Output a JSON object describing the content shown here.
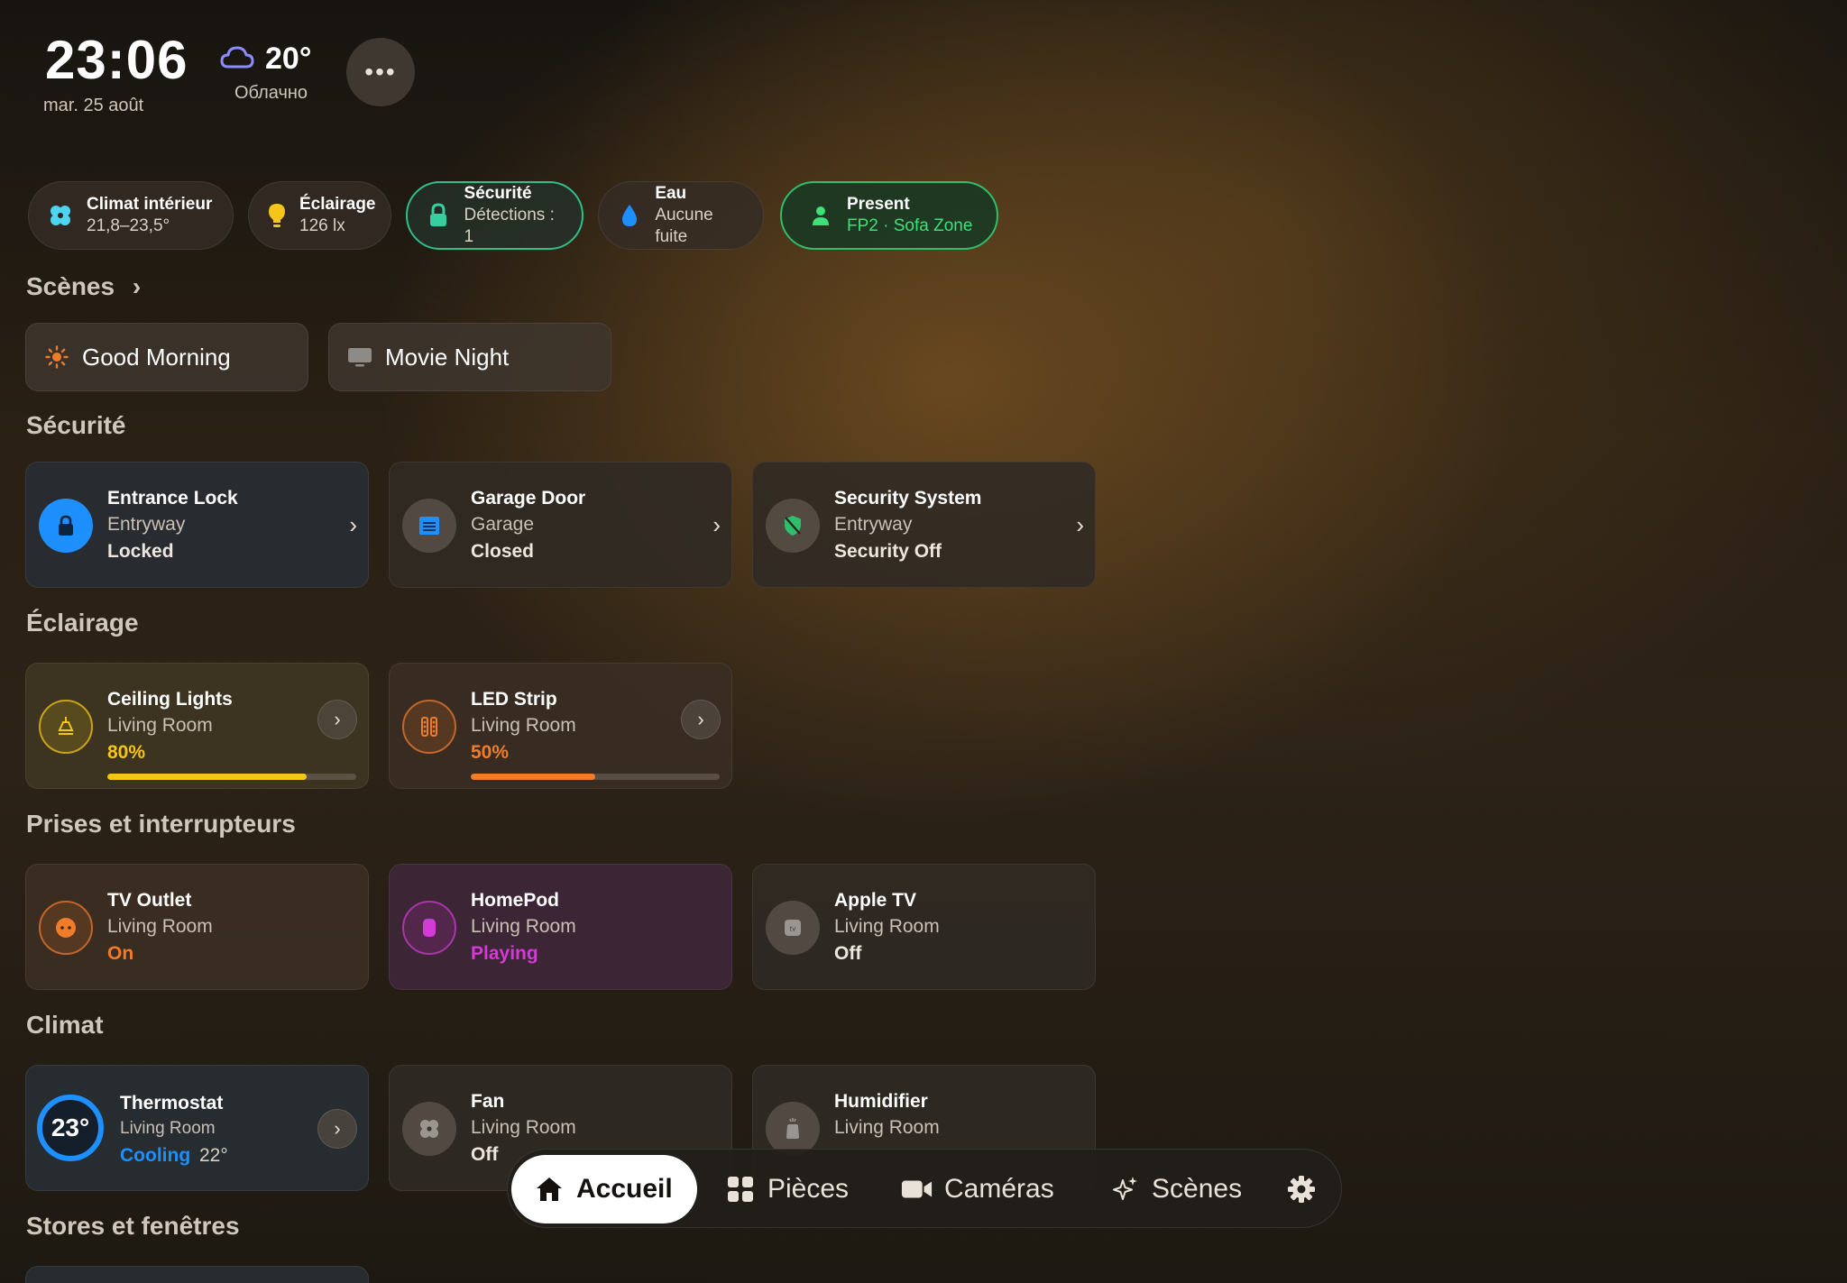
{
  "header": {
    "time": "23:06",
    "date": "mar. 25 août",
    "temperature": "20°",
    "condition": "Облачно",
    "more_label": "•••"
  },
  "status_chips": [
    {
      "title": "Climat intérieur",
      "subtitle": "21,8–23,5°",
      "icon": "fan-icon"
    },
    {
      "title": "Éclairage",
      "subtitle": "126 lx",
      "icon": "bulb-icon"
    },
    {
      "title": "Sécurité",
      "subtitle": "Détections : 1",
      "icon": "lock-icon"
    },
    {
      "title": "Eau",
      "subtitle": "Aucune fuite",
      "icon": "water-drop-icon"
    },
    {
      "title": "Present",
      "subtitle": "FP2 · Sofa Zone",
      "icon": "person-icon"
    }
  ],
  "sections": {
    "scenes": "Scènes",
    "security": "Sécurité",
    "lighting": "Éclairage",
    "outlets": "Prises et interrupteurs",
    "climate": "Climat",
    "blinds": "Stores et fenêtres"
  },
  "scenes": [
    {
      "label": "Good Morning",
      "icon": "sun-icon"
    },
    {
      "label": "Movie Night",
      "icon": "tv-icon"
    }
  ],
  "security_devices": [
    {
      "name": "Entrance Lock",
      "room": "Entryway",
      "state": "Locked"
    },
    {
      "name": "Garage Door",
      "room": "Garage",
      "state": "Closed"
    },
    {
      "name": "Security System",
      "room": "Entryway",
      "state": "Security Off"
    }
  ],
  "lights": [
    {
      "name": "Ceiling Lights",
      "room": "Living Room",
      "state": "80%",
      "level": 0.8
    },
    {
      "name": "LED Strip",
      "room": "Living Room",
      "state": "50%",
      "level": 0.5
    }
  ],
  "outlets": [
    {
      "name": "TV Outlet",
      "room": "Living Room",
      "state": "On"
    },
    {
      "name": "HomePod",
      "room": "Living Room",
      "state": "Playing"
    },
    {
      "name": "Apple TV",
      "room": "Living Room",
      "state": "Off"
    }
  ],
  "climate": [
    {
      "name": "Thermostat",
      "room": "Living Room",
      "state": "Cooling",
      "target": "22°",
      "current": "23°"
    },
    {
      "name": "Fan",
      "room": "Living Room",
      "state": "Off"
    },
    {
      "name": "Humidifier",
      "room": "Living Room",
      "state": ""
    }
  ],
  "nav": {
    "home": "Accueil",
    "rooms": "Pièces",
    "cameras": "Caméras",
    "scenes": "Scènes"
  },
  "colors": {
    "accent_blue": "#1e8fff",
    "light_yellow": "#f5c518",
    "strip_orange": "#f07c2a",
    "homepod_magenta": "#d63ad6",
    "present_green": "#3ee07a"
  }
}
